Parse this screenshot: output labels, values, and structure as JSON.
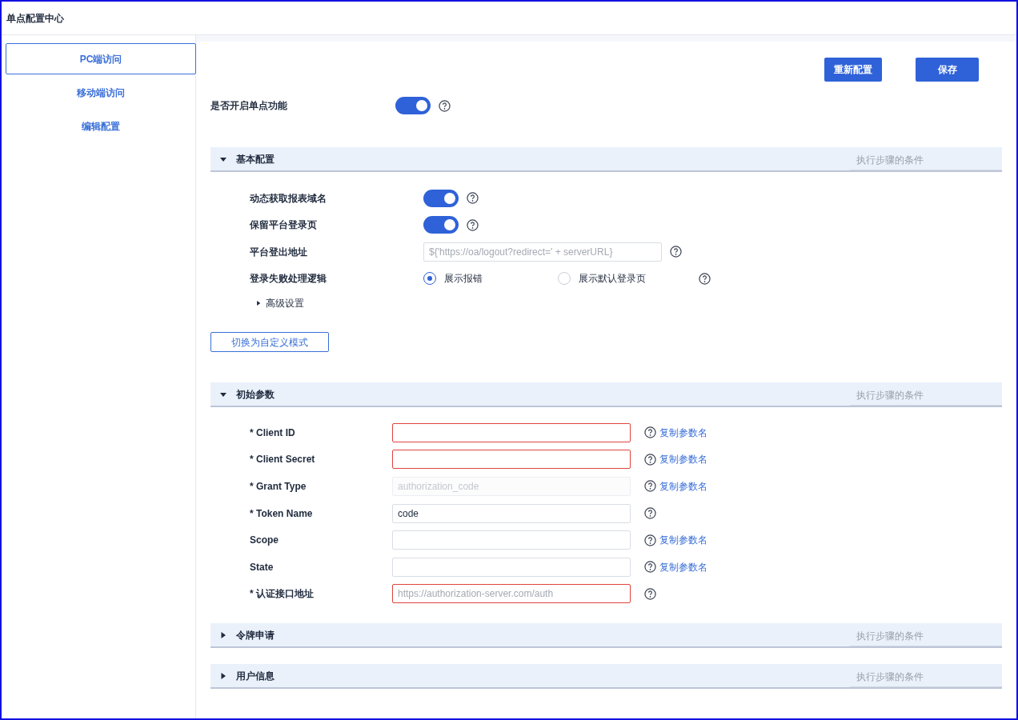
{
  "window": {
    "title": "单点配置中心"
  },
  "sidebar": {
    "items": [
      {
        "label": "PC端访问",
        "selected": true
      },
      {
        "label": "移动端访问",
        "selected": false
      },
      {
        "label": "编辑配置",
        "selected": false
      }
    ]
  },
  "toolbar": {
    "buttons": [
      "重新配置",
      "保存"
    ]
  },
  "master_switch": {
    "label": "是否开启单点功能",
    "on": true
  },
  "sections": [
    {
      "title": "基本配置",
      "expanded": true,
      "condition_placeholder": "执行步骤的条件",
      "kind": "basic",
      "rows": [
        {
          "kind": "toggle",
          "label": "动态获取报表域名",
          "on": true
        },
        {
          "kind": "toggle",
          "label": "保留平台登录页",
          "on": true
        },
        {
          "kind": "text",
          "label": "平台登出地址",
          "placeholder": "${'https://oa/logout?redirect=' + serverURL}"
        },
        {
          "kind": "radio",
          "label": "登录失败处理逻辑",
          "options": [
            {
              "label": "展示报错",
              "selected": true
            },
            {
              "label": "展示默认登录页",
              "selected": false
            }
          ]
        }
      ],
      "advanced": {
        "label": "高级设置",
        "expanded": false
      },
      "mode_button": "切换为自定义模式"
    },
    {
      "title": "初始参数",
      "expanded": true,
      "condition_placeholder": "执行步骤的条件",
      "kind": "params",
      "params": [
        {
          "label": "* Client ID",
          "invalid": true,
          "disabled": false,
          "copy": "复制参数名"
        },
        {
          "label": "* Client Secret",
          "invalid": true,
          "disabled": false,
          "copy": "复制参数名"
        },
        {
          "label": "* Grant Type",
          "placeholder": "authorization_code",
          "invalid": false,
          "disabled": true,
          "copy": "复制参数名"
        },
        {
          "label": "* Token Name",
          "value": "code",
          "invalid": false,
          "disabled": false
        },
        {
          "label": "Scope",
          "invalid": false,
          "disabled": false,
          "copy": "复制参数名"
        },
        {
          "label": "State",
          "invalid": false,
          "disabled": false,
          "copy": "复制参数名"
        },
        {
          "label": "* 认证接口地址",
          "placeholder": "https://authorization-server.com/auth",
          "invalid": true,
          "disabled": false
        }
      ]
    },
    {
      "title": "令牌申请",
      "expanded": false,
      "condition_placeholder": "执行步骤的条件"
    },
    {
      "title": "用户信息",
      "expanded": false,
      "condition_placeholder": "执行步骤的条件"
    }
  ]
}
